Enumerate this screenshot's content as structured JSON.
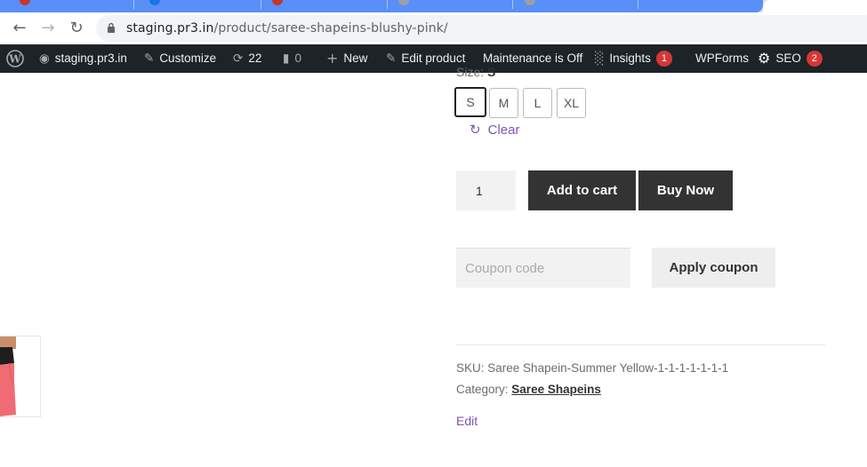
{
  "browser": {
    "url_host": "staging.pr3.in",
    "url_path": "/product/saree-shapeins-blushy-pink/",
    "colors": {
      "tab_strip": "#5a8ff7"
    }
  },
  "admin_bar": {
    "site_name": "staging.pr3.in",
    "customize": "Customize",
    "updates_count": "22",
    "comments_count": "0",
    "new": "New",
    "edit_product": "Edit product",
    "maintenance": "Maintenance is Off",
    "insights": "Insights",
    "insights_badge": "1",
    "wpforms": "WPForms",
    "seo": "SEO",
    "seo_badge": "2"
  },
  "product": {
    "size_label": "Size:",
    "size_value": "S",
    "sizes": [
      "S",
      "M",
      "L",
      "XL"
    ],
    "selected_size": "S",
    "clear": "Clear",
    "quantity": "1",
    "add_to_cart": "Add to cart",
    "buy_now": "Buy Now",
    "coupon_placeholder": "Coupon code",
    "apply_coupon": "Apply coupon",
    "sku_label": "SKU:",
    "sku_value": "Saree Shapein-Summer Yellow-1-1-1-1-1-1-1",
    "category_label": "Category:",
    "category_value": "Saree Shapeins",
    "edit": "Edit"
  }
}
